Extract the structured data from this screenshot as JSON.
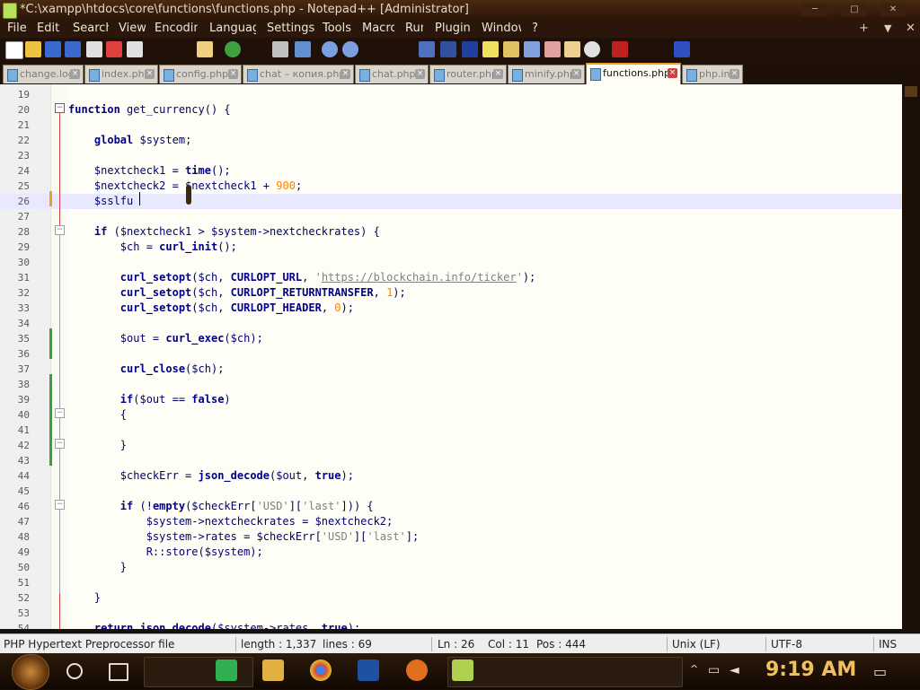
{
  "window": {
    "title": "*C:\\xampp\\htdocs\\core\\functions\\functions.php - Notepad++ [Administrator]",
    "controls": [
      "─",
      "□",
      "✕"
    ]
  },
  "menu": {
    "items": [
      "File",
      "Edit",
      "Search",
      "View",
      "Encoding",
      "Language",
      "Settings",
      "Tools",
      "Macro",
      "Run",
      "Plugins",
      "Window",
      "?"
    ],
    "right": [
      "+",
      "▼",
      "✕"
    ]
  },
  "tabs": [
    {
      "label": "change.log",
      "active": false
    },
    {
      "label": "index.php",
      "active": false
    },
    {
      "label": "config.php",
      "active": false
    },
    {
      "label": "chat – копия.php",
      "active": false
    },
    {
      "label": "chat.php",
      "active": false
    },
    {
      "label": "router.php",
      "active": false
    },
    {
      "label": "minify.php",
      "active": false
    },
    {
      "label": "functions.php",
      "active": true
    },
    {
      "label": "php.ini",
      "active": false
    }
  ],
  "editor": {
    "current_line": 26,
    "lines": [
      {
        "n": "19",
        "html": ""
      },
      {
        "n": "20",
        "html": "<span class='kw'>function</span> get_currency() {"
      },
      {
        "n": "21",
        "html": ""
      },
      {
        "n": "22",
        "html": "    <span class='kw'>global</span> <span class='var'>$system</span>;"
      },
      {
        "n": "23",
        "html": ""
      },
      {
        "n": "24",
        "html": "    <span class='var'>$nextcheck1</span> = <span class='fn'>time</span>();"
      },
      {
        "n": "25",
        "html": "    <span class='var'>$nextcheck2</span> = <span class='var'>$nextcheck1</span> + <span class='num'>900</span>;"
      },
      {
        "n": "26",
        "html": "    <span class='var'>$sslfu</span>"
      },
      {
        "n": "27",
        "html": ""
      },
      {
        "n": "28",
        "html": "    <span class='kw'>if</span> (<span class='var'>$nextcheck1</span> &gt; <span class='var'>$system</span>-&gt;nextcheckrates) {"
      },
      {
        "n": "29",
        "html": "        <span class='var'>$ch</span> = <span class='fn'>curl_init</span>();"
      },
      {
        "n": "30",
        "html": ""
      },
      {
        "n": "31",
        "html": "        <span class='fn'>curl_setopt</span>(<span class='var'>$ch</span>, <span class='fn'>CURLOPT_URL</span>, <span class='str'>'</span><span class='strlink'>https://blockchain.info/ticker</span><span class='str'>'</span>);"
      },
      {
        "n": "32",
        "html": "        <span class='fn'>curl_setopt</span>(<span class='var'>$ch</span>, <span class='fn'>CURLOPT_RETURNTRANSFER</span>, <span class='num'>1</span>);"
      },
      {
        "n": "33",
        "html": "        <span class='fn'>curl_setopt</span>(<span class='var'>$ch</span>, <span class='fn'>CURLOPT_HEADER</span>, <span class='num'>0</span>);"
      },
      {
        "n": "34",
        "html": ""
      },
      {
        "n": "35",
        "html": "        <span class='var'>$out</span> = <span class='fn'>curl_exec</span>(<span class='var'>$ch</span>);"
      },
      {
        "n": "36",
        "html": ""
      },
      {
        "n": "37",
        "html": "        <span class='fn'>curl_close</span>(<span class='var'>$ch</span>);"
      },
      {
        "n": "38",
        "html": ""
      },
      {
        "n": "39",
        "html": "        <span class='kw'>if</span>(<span class='var'>$out</span> == <span class='kw'>false</span>)"
      },
      {
        "n": "40",
        "html": "        {"
      },
      {
        "n": "41",
        "html": ""
      },
      {
        "n": "42",
        "html": "        }"
      },
      {
        "n": "43",
        "html": ""
      },
      {
        "n": "44",
        "html": "        <span class='var'>$checkErr</span> = <span class='fn'>json_decode</span>(<span class='var'>$out</span>, <span class='kw'>true</span>);"
      },
      {
        "n": "45",
        "html": ""
      },
      {
        "n": "46",
        "html": "        <span class='kw'>if</span> (!<span class='fn'>empty</span>(<span class='var'>$checkErr</span>[<span class='str'>'USD'</span>][<span class='str'>'last'</span>])) {"
      },
      {
        "n": "47",
        "html": "            <span class='var'>$system</span>-&gt;nextcheckrates = <span class='var'>$nextcheck2</span>;"
      },
      {
        "n": "48",
        "html": "            <span class='var'>$system</span>-&gt;rates = <span class='var'>$checkErr</span>[<span class='str'>'USD'</span>][<span class='str'>'last'</span>];"
      },
      {
        "n": "49",
        "html": "            R::store(<span class='var'>$system</span>);"
      },
      {
        "n": "50",
        "html": "        }"
      },
      {
        "n": "51",
        "html": ""
      },
      {
        "n": "52",
        "html": "    }"
      },
      {
        "n": "53",
        "html": ""
      },
      {
        "n": "54",
        "html": "    <span class='kw'>return</span> <span class='fn'>json_decode</span>(<span class='var'>$system</span>-&gt;rates, <span class='kw'>true</span>);"
      }
    ]
  },
  "status": {
    "file_type": "PHP Hypertext Preprocessor file",
    "length": "length : 1,337",
    "lines": "lines : 69",
    "ln": "Ln : 26",
    "col": "Col : 11",
    "pos": "Pos : 444",
    "eol": "Unix (LF)",
    "encoding": "UTF-8",
    "mode": "INS"
  },
  "taskbar": {
    "clock": "9:19 AM"
  },
  "colors": {
    "accent": "#f0a020",
    "keyword": "#000088",
    "number": "#ff8000",
    "string": "#808080",
    "fold_marker": "#c04040",
    "change_bar": "#3aa03a"
  }
}
